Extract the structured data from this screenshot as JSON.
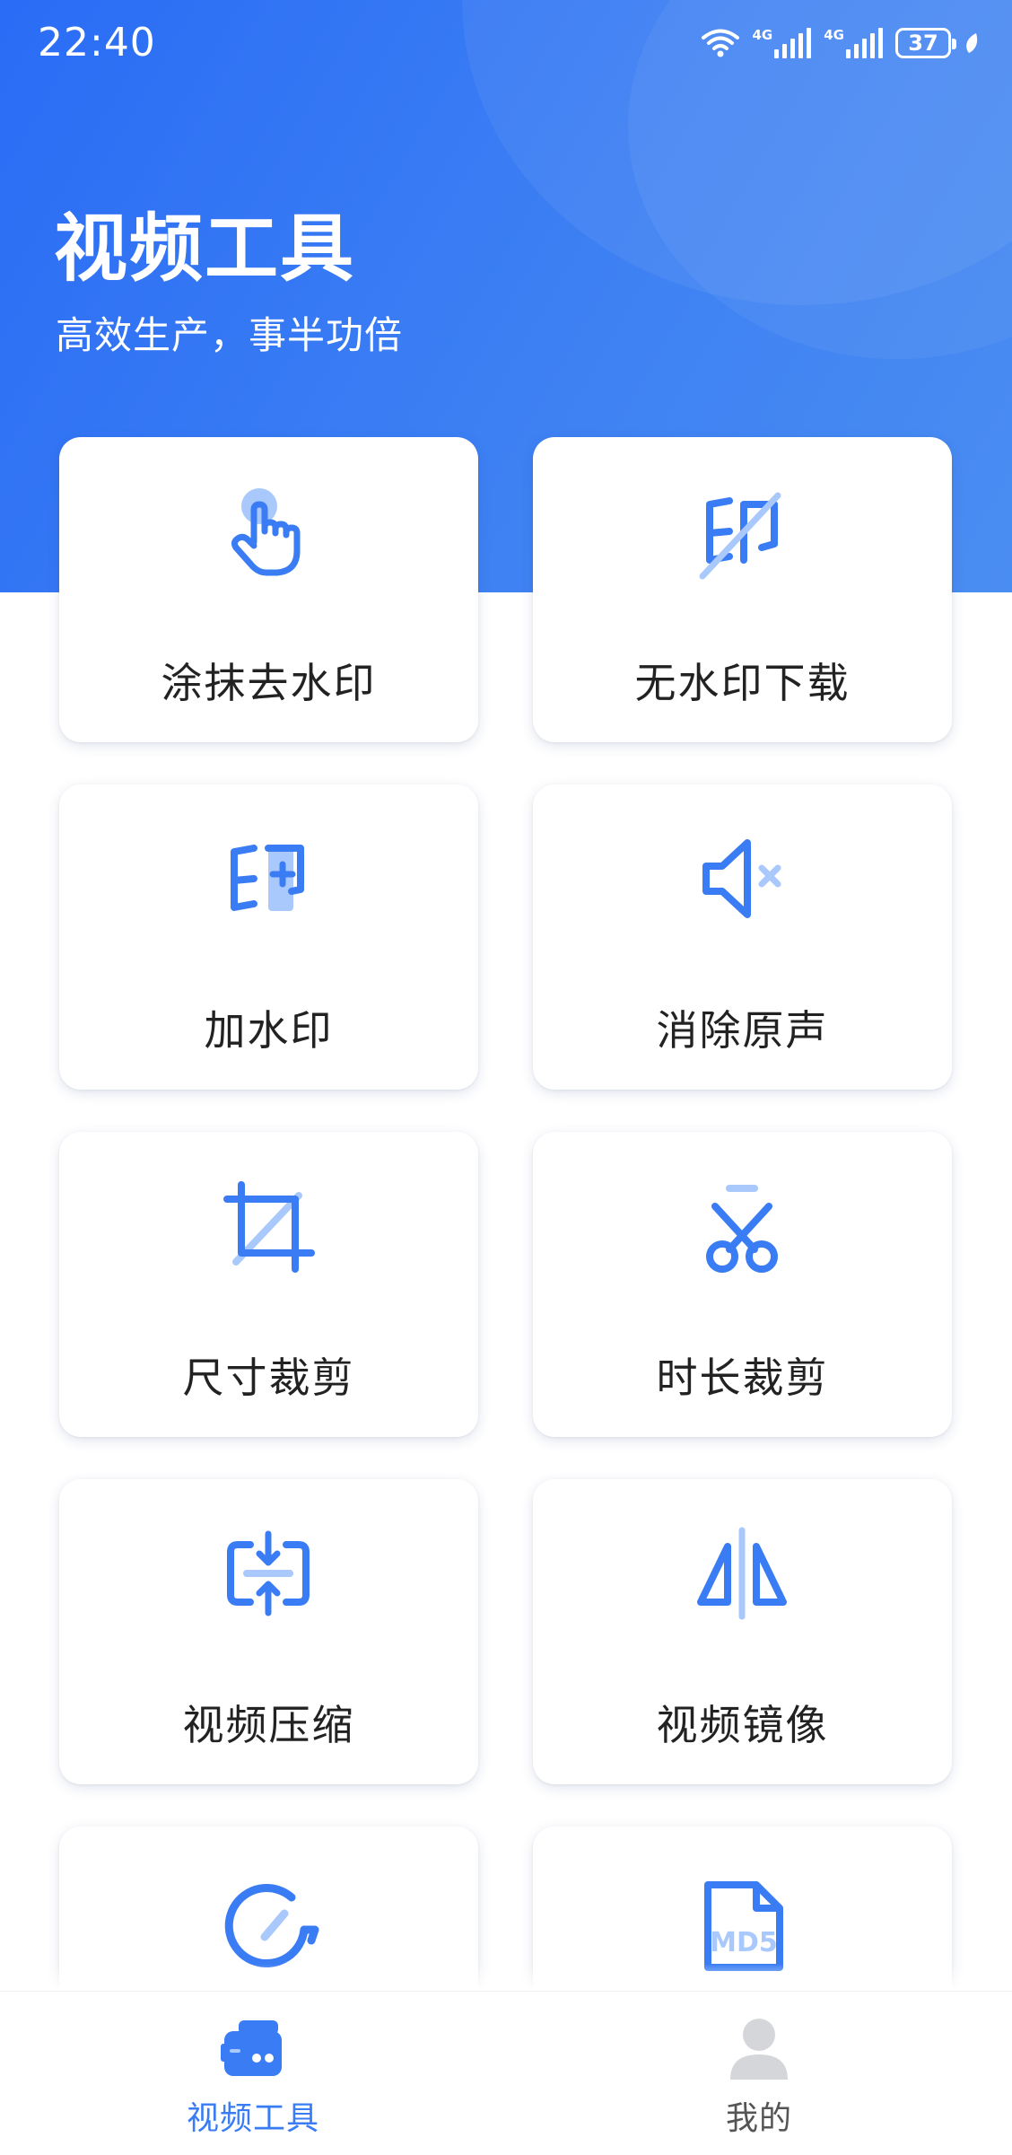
{
  "status_bar": {
    "time": "22:40",
    "network_1": "4G",
    "network_2": "4G",
    "battery": "37"
  },
  "header": {
    "title": "视频工具",
    "subtitle": "高效生产，事半功倍"
  },
  "tools": [
    {
      "label": "涂抹去水印",
      "icon": "finger-tap-icon"
    },
    {
      "label": "无水印下载",
      "icon": "no-watermark-icon"
    },
    {
      "label": "加水印",
      "icon": "add-watermark-icon"
    },
    {
      "label": "消除原声",
      "icon": "mute-icon"
    },
    {
      "label": "尺寸裁剪",
      "icon": "crop-icon"
    },
    {
      "label": "时长裁剪",
      "icon": "scissors-icon"
    },
    {
      "label": "视频压缩",
      "icon": "compress-icon"
    },
    {
      "label": "视频镜像",
      "icon": "mirror-icon"
    },
    {
      "label": "",
      "icon": "speed-gauge-icon"
    },
    {
      "label": "MD5",
      "icon": "md5-file-icon"
    }
  ],
  "tabbar": {
    "tabs": [
      {
        "label": "视频工具",
        "icon": "video-toolbox-icon",
        "active": true
      },
      {
        "label": "我的",
        "icon": "user-profile-icon",
        "active": false
      }
    ]
  },
  "colors": {
    "accent": "#3a7cf3",
    "accent_light": "#a9c8fb",
    "header_start": "#2a6cf5",
    "header_end": "#4a8df2",
    "tab_active": "#3a7cf3",
    "tab_inactive": "#555555"
  }
}
